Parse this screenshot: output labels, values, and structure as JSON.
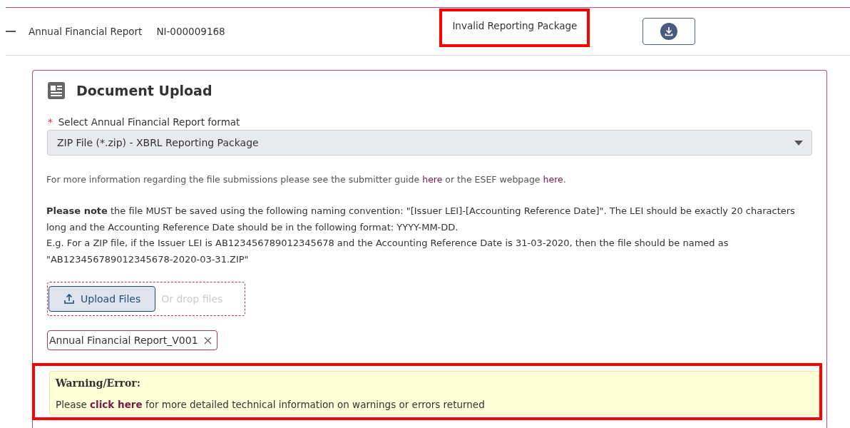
{
  "report_row": {
    "expanded": true,
    "title": "Annual Financial Report",
    "reference": "NI-000009168",
    "status": "Invalid Reporting Package",
    "status_highlighted": true
  },
  "upload_panel": {
    "title": "Document Upload",
    "format_field": {
      "label": "Select Annual Financial Report format",
      "required": true,
      "required_marker": "*",
      "value": "ZIP File (*.zip) - XBRL Reporting Package"
    },
    "info": {
      "before": "For more information regarding the file submissions please see the submitter guide",
      "link_1": "here",
      "middle": "or the ESEF webpage",
      "link_2": "here",
      "after": "."
    },
    "note_lines": [
      "**Please note** the file MUST be saved using the following naming convention: \"[Issuer LEI]-[Accounting Reference Date]\". The LEI should be exactly 20 characters long and the Accounting Reference Date should be in the following format: YYYY-MM-DD.",
      "E.g. For a ZIP file, if the Issuer LEI is AB123456789012345678 and the Accounting Reference Date is 31-03-2020, then the file should be named as \"AB123456789012345678-2020-03-31.ZIP\""
    ],
    "upload_button": "Upload Files",
    "drop_hint": "Or drop files",
    "files": [
      "Annual Financial Report_V001"
    ],
    "warning": {
      "title": "Warning/Error:",
      "before": "Please",
      "link": "click here",
      "after": "for more detailed technical information on warnings or errors returned",
      "highlighted": true
    }
  }
}
